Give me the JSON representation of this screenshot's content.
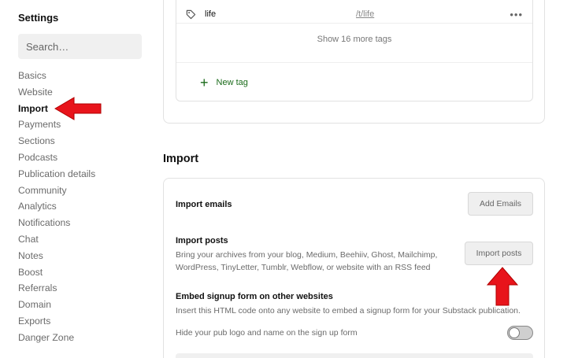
{
  "sidebar": {
    "title": "Settings",
    "search_placeholder": "Search…",
    "items": [
      {
        "label": "Basics"
      },
      {
        "label": "Website"
      },
      {
        "label": "Import"
      },
      {
        "label": "Payments"
      },
      {
        "label": "Sections"
      },
      {
        "label": "Podcasts"
      },
      {
        "label": "Publication details"
      },
      {
        "label": "Community"
      },
      {
        "label": "Analytics"
      },
      {
        "label": "Notifications"
      },
      {
        "label": "Chat"
      },
      {
        "label": "Notes"
      },
      {
        "label": "Boost"
      },
      {
        "label": "Referrals"
      },
      {
        "label": "Domain"
      },
      {
        "label": "Exports"
      },
      {
        "label": "Danger Zone"
      }
    ],
    "active_item": "Import"
  },
  "tags": {
    "row": {
      "name": "life",
      "url": "/t/life"
    },
    "show_more": "Show 16 more tags",
    "new_tag": "New tag"
  },
  "import_section": {
    "heading": "Import",
    "emails": {
      "title": "Import emails",
      "button": "Add Emails"
    },
    "posts": {
      "title": "Import posts",
      "description": "Bring your archives from your blog, Medium, Beehiiv, Ghost, Mailchimp, WordPress, TinyLetter, Tumblr, Webflow, or website with an RSS feed",
      "button": "Import posts"
    },
    "embed": {
      "title": "Embed signup form on other websites",
      "description": "Insert this HTML code onto any website to embed a signup form for your Substack publication.",
      "toggle_label": "Hide your pub logo and name on the sign up form",
      "toggle_on": false
    }
  },
  "colors": {
    "annotation_red": "#e8141b",
    "accent_green": "#1a6b1a"
  }
}
